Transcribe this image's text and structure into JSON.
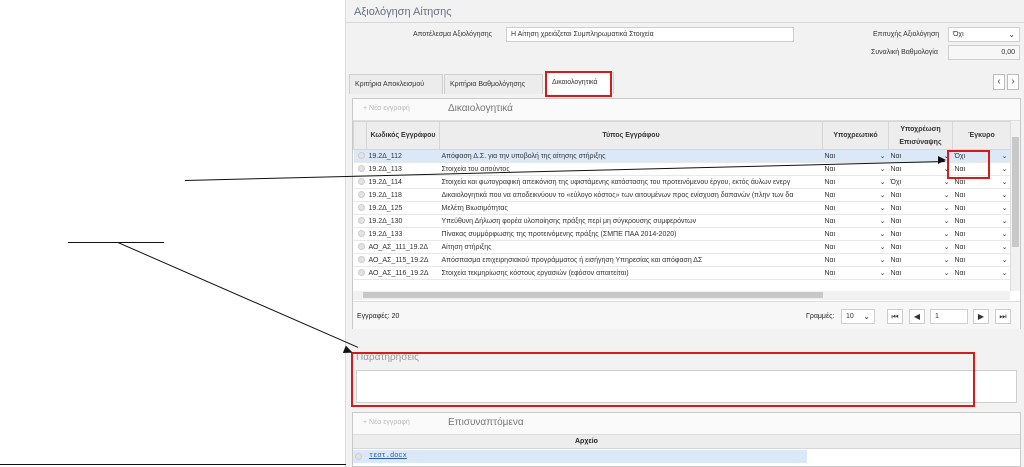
{
  "section": {
    "title": "Αξιολόγηση Αίτησης"
  },
  "evaluation": {
    "result_label": "Αποτέλεσμα Αξιολόγησης",
    "result_value": "Η Αίτηση χρειάζεται Συμπληρωματικά Στοιχεία",
    "success_label": "Επιτυχής Αξιολόγηση",
    "success_value": "Όχι",
    "score_label": "Συναλική Βαθμολογία",
    "score_value": "0,00"
  },
  "tabs": [
    {
      "label": "Κριτήρια Αποκλεισμού"
    },
    {
      "label": "Κριτήρια Βαθμολόγησης"
    },
    {
      "label": "Δικαιολογητικά"
    }
  ],
  "docs_grid": {
    "new_entry": "Νέα εγγραφή",
    "title": "Δικαιολογητικά",
    "columns": [
      "Κωδικός Εγγράφου",
      "Τύπος Εγγράφου",
      "Υποχρεωτικό",
      "Υποχρέωση Επισύναψης",
      "Έγκυρο"
    ],
    "rows": [
      {
        "code": "19.2Δ_112",
        "type": "Απόφαση Δ.Σ. για την υποβολή της αίτησης στήριξης",
        "mandatory": "Ναι",
        "attach": "Ναι",
        "valid": "Όχι"
      },
      {
        "code": "19.2Δ_113",
        "type": "Στοιχεία του αιτούντος",
        "mandatory": "Ναι",
        "attach": "Ναι",
        "valid": "Ναι"
      },
      {
        "code": "19.2Δ_114",
        "type": "Στοιχεία και φωτογραφική απεικόνιση της υφιστάμενης κατάστασης του προτεινόμενου έργου, εκτός άυλων ενεργ",
        "mandatory": "Ναι",
        "attach": "Όχι",
        "valid": "Ναι"
      },
      {
        "code": "19.2Δ_118",
        "type": "Δικαιολογητικά που να αποδεικνύουν το «εύλογο κόστος» των αιτουμένων προς ενίσχυση δαπανών (πλην των δα",
        "mandatory": "Ναι",
        "attach": "Ναι",
        "valid": "Ναι"
      },
      {
        "code": "19.2Δ_125",
        "type": "Μελέτη Βιωσιμότητας",
        "mandatory": "Ναι",
        "attach": "Ναι",
        "valid": "Ναι"
      },
      {
        "code": "19.2Δ_130",
        "type": "Υπεύθυνη Δήλωση φορέα υλοποίησης πράξης περί μη σύγκρουσης συμφερόντων",
        "mandatory": "Ναι",
        "attach": "Ναι",
        "valid": "Ναι"
      },
      {
        "code": "19.2Δ_133",
        "type": "Πίνακας συμμόρφωσης της προτεινόμενης πράξης (ΣΜΠΕ ΠΑΑ 2014-2020)",
        "mandatory": "Ναι",
        "attach": "Ναι",
        "valid": "Ναι"
      },
      {
        "code": "ΑΟ_ΑΣ_111_19.2Δ",
        "type": "Αίτηση στήριξης",
        "mandatory": "Ναι",
        "attach": "Ναι",
        "valid": "Ναι"
      },
      {
        "code": "ΑΟ_ΑΣ_115_19.2Δ",
        "type": "Απόσπασμα επιχειρησιακού προγράμματος ή εισήγηση Υπηρεσίας και απόφαση ΔΣ",
        "mandatory": "Ναι",
        "attach": "Ναι",
        "valid": "Ναι"
      },
      {
        "code": "ΑΟ_ΑΣ_116_19.2Δ",
        "type": "Στοιχεία τεκμηρίωσης κόστους εργασιών (εφόσον απαιτείται)",
        "mandatory": "Ναι",
        "attach": "Ναι",
        "valid": "Ναι"
      }
    ],
    "records_label": "Εγγραφές: 20",
    "rows_label": "Γραμμές:",
    "rows_value": "10",
    "page_value": "1"
  },
  "remarks": {
    "label": "Παρατηρήσεις"
  },
  "attachments": {
    "new_entry": "Νέα εγγραφή",
    "title": "Επισυναπτόμενα",
    "column": "Αρχείο",
    "file": "τεστ.docx"
  },
  "colors": {
    "highlight": "#d41c1c",
    "selected_row": "#dbe8f7",
    "title": "#6a6f86"
  }
}
